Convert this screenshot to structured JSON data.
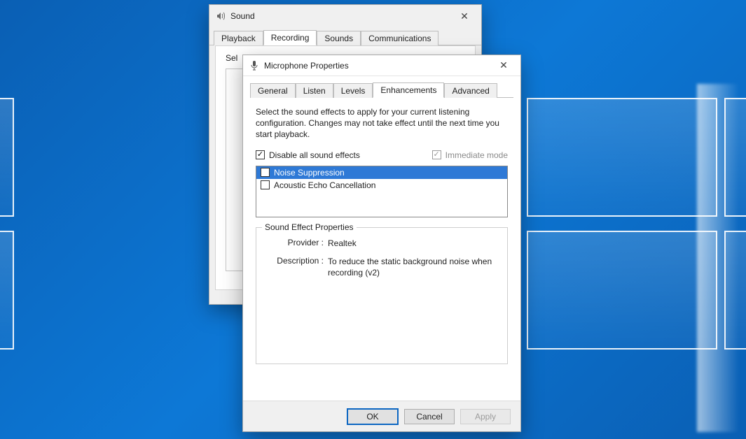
{
  "wallpaper": {
    "name": "windows-10-light-panes"
  },
  "sound_dialog": {
    "title": "Sound",
    "tabs": [
      "Playback",
      "Recording",
      "Sounds",
      "Communications"
    ],
    "active_tab_index": 1,
    "instruction": "Sel",
    "close_glyph": "✕"
  },
  "mic_dialog": {
    "title": "Microphone Properties",
    "close_glyph": "✕",
    "tabs": [
      "General",
      "Listen",
      "Levels",
      "Enhancements",
      "Advanced"
    ],
    "active_tab_index": 3,
    "description": "Select the sound effects to apply for your current listening configuration. Changes may not take effect until the next time you start playback.",
    "disable_all_label": "Disable all sound effects",
    "disable_all_checked": true,
    "immediate_label": "Immediate mode",
    "immediate_checked": true,
    "immediate_disabled": true,
    "effects": [
      {
        "name": "Noise Suppression",
        "checked": false,
        "selected": true
      },
      {
        "name": "Acoustic Echo Cancellation",
        "checked": false,
        "selected": false
      }
    ],
    "properties": {
      "legend": "Sound Effect Properties",
      "provider_label": "Provider :",
      "provider_value": "Realtek",
      "description_label": "Description :",
      "description_value": "To reduce the static background noise when recording (v2)"
    },
    "buttons": {
      "ok": "OK",
      "cancel": "Cancel",
      "apply": "Apply"
    }
  }
}
